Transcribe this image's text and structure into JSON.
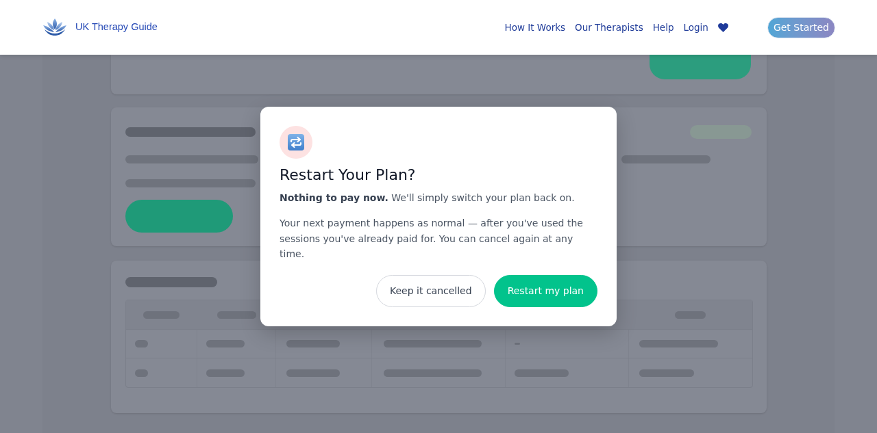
{
  "header": {
    "brand": "UK Therapy Guide",
    "nav_links": [
      "How It Works",
      "Our Therapists",
      "Help",
      "Login"
    ],
    "cta_button": "Get Started"
  },
  "dialog": {
    "title": "Restart Your Plan?",
    "intro": "**Nothing to pay now.** We'll simply switch your plan back on.",
    "body": "Your next payment happens as normal — after you've used the sessions you've already paid for. You can cancel again at any time.",
    "buttons": [
      {
        "label": "Keep it cancelled",
        "kind": "secondary"
      },
      {
        "label": "Restart my plan",
        "kind": "primary"
      }
    ]
  }
}
